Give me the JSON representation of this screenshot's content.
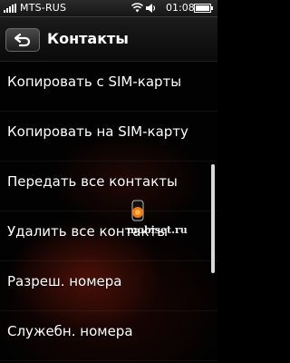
{
  "status_bar": {
    "operator": "MTS-RUS",
    "time": "01:08"
  },
  "header": {
    "title": "Контакты"
  },
  "menu": {
    "items": [
      {
        "label": "Копировать с SIM-карты"
      },
      {
        "label": "Копировать на SIM-карту"
      },
      {
        "label": "Передать все контакты"
      },
      {
        "label": "Удалить все контакты"
      },
      {
        "label": "Разреш. номера"
      },
      {
        "label": "Служебн. номера"
      }
    ]
  },
  "scrollbar": {
    "position_fraction": 0.34,
    "visible_fraction": 0.36
  },
  "watermark": {
    "text": "mobiset.ru"
  },
  "icons": {
    "signal": "signal-strength-icon",
    "wifi": "wifi-icon",
    "speaker": "speaker-icon",
    "battery": "battery-icon",
    "back": "back-arrow-icon"
  }
}
